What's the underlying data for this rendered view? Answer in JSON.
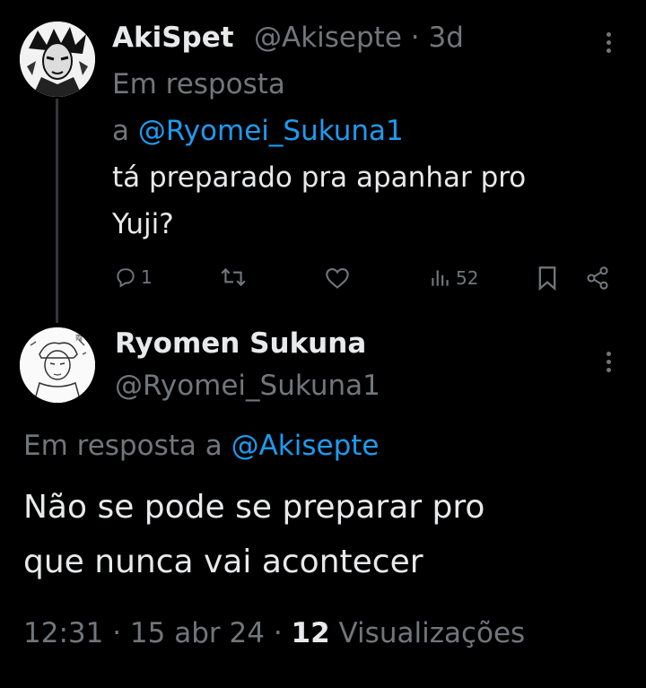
{
  "tweet1": {
    "author_name": "AkiSpet",
    "author_handle": "@Akisepte",
    "separator": "·",
    "time_ago": "3d",
    "reply_prefix_line1": "Em resposta",
    "reply_prefix_line2": "a",
    "reply_to": "@Ryomei_Sukuna1",
    "text_line1": "tá preparado pra apanhar pro",
    "text_line2": "Yuji?",
    "actions": {
      "reply_count": "1",
      "views_count": "52"
    }
  },
  "tweet2": {
    "author_name": "Ryomen Sukuna",
    "author_handle": "@Ryomei_Sukuna1",
    "reply_prefix": "Em resposta a",
    "reply_to": "@Akisepte",
    "text_line1": "Não se pode se preparar pro",
    "text_line2": "que nunca vai acontecer",
    "time": "12:31",
    "dot1": "·",
    "date": "15 abr 24",
    "dot2": "·",
    "views_count": "12",
    "views_label": "Visualizações"
  },
  "colors": {
    "background": "#000000",
    "text": "#e7e9ea",
    "muted": "#71767b",
    "link": "#1d9bf0"
  },
  "icons": [
    "reply-icon",
    "retweet-icon",
    "like-icon",
    "views-icon",
    "bookmark-icon",
    "share-icon",
    "more-icon"
  ]
}
